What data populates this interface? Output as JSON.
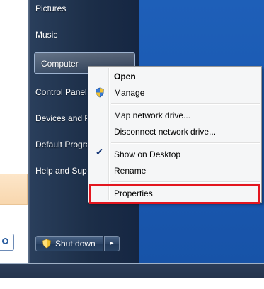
{
  "start_menu": {
    "items": [
      {
        "label": "Pictures"
      },
      {
        "label": "Music"
      },
      {
        "label": "Computer"
      },
      {
        "label": "Control Panel"
      },
      {
        "label": "Devices and Printers"
      },
      {
        "label": "Default Programs"
      },
      {
        "label": "Help and Support"
      }
    ],
    "shutdown_label": "Shut down"
  },
  "context_menu": {
    "items": [
      {
        "label": "Open"
      },
      {
        "label": "Manage"
      },
      {
        "label": "Map network drive..."
      },
      {
        "label": "Disconnect network drive..."
      },
      {
        "label": "Show on Desktop"
      },
      {
        "label": "Rename"
      },
      {
        "label": "Properties"
      }
    ]
  },
  "colors": {
    "highlight_box": "#e3161f",
    "desktop": "#1e5fb8",
    "menu_dark": "#1c2e48"
  },
  "icons": [
    "search-icon",
    "shield-icon",
    "checkmark-icon",
    "arrow-right-icon"
  ]
}
